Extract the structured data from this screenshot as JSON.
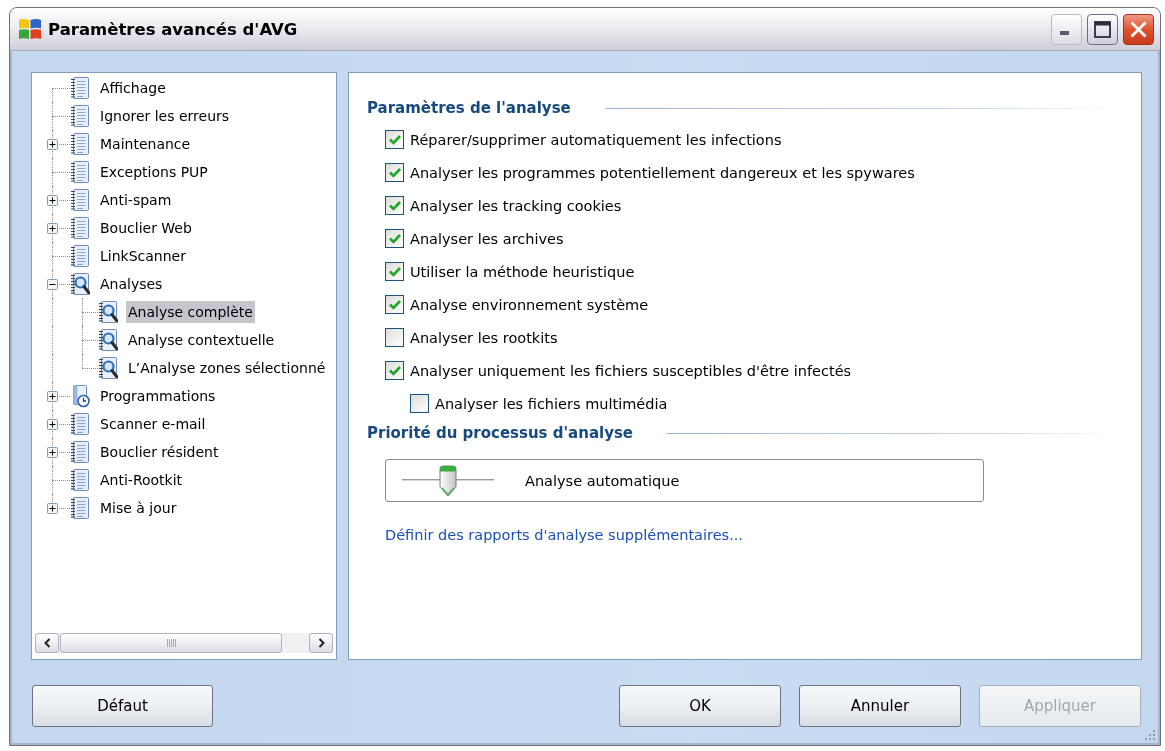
{
  "window": {
    "title": "Paramètres avancés d'AVG"
  },
  "tree": {
    "items": [
      {
        "label": "Affichage",
        "kind": "notepad",
        "selected": false
      },
      {
        "label": "Ignorer les erreurs",
        "kind": "notepad",
        "selected": false
      },
      {
        "label": "Maintenance",
        "kind": "notepad",
        "selected": false,
        "expanded": false
      },
      {
        "label": "Exceptions PUP",
        "kind": "notepad",
        "selected": false
      },
      {
        "label": "Anti-spam",
        "kind": "notepad",
        "selected": false,
        "expanded": false
      },
      {
        "label": "Bouclier Web",
        "kind": "notepad",
        "selected": false,
        "expanded": false
      },
      {
        "label": "LinkScanner",
        "kind": "notepad",
        "selected": false
      },
      {
        "label": "Analyses",
        "kind": "scan",
        "selected": false,
        "expanded": true,
        "children": [
          {
            "label": "Analyse complète",
            "kind": "scan",
            "selected": true
          },
          {
            "label": "Analyse contextuelle",
            "kind": "scan",
            "selected": false
          },
          {
            "label": "L’Analyse zones sélectionné",
            "kind": "scan",
            "selected": false
          }
        ]
      },
      {
        "label": "Programmations",
        "kind": "schedule",
        "selected": false,
        "expanded": false
      },
      {
        "label": "Scanner e-mail",
        "kind": "notepad",
        "selected": false,
        "expanded": false
      },
      {
        "label": "Bouclier résident",
        "kind": "notepad",
        "selected": false,
        "expanded": false
      },
      {
        "label": "Anti-Rootkit",
        "kind": "notepad",
        "selected": false
      },
      {
        "label": "Mise à jour",
        "kind": "notepad",
        "selected": false,
        "expanded": false
      }
    ]
  },
  "analysis_settings": {
    "title": "Paramètres de l'analyse",
    "options": [
      {
        "label": "Réparer/supprimer automatiquement les infections",
        "checked": true
      },
      {
        "label": "Analyser les programmes potentiellement dangereux et les spywares",
        "checked": true
      },
      {
        "label": "Analyser les tracking cookies",
        "checked": true
      },
      {
        "label": "Analyser les archives",
        "checked": true
      },
      {
        "label": "Utiliser la méthode heuristique",
        "checked": true
      },
      {
        "label": "Analyse environnement système",
        "checked": true
      },
      {
        "label": "Analyser les rootkits",
        "checked": false
      },
      {
        "label": "Analyser uniquement les fichiers susceptibles d'être infectés",
        "checked": true,
        "children": [
          {
            "label": "Analyser les fichiers multimédia",
            "checked": false
          }
        ]
      }
    ]
  },
  "priority": {
    "title": "Priorité du processus d'analyse",
    "slider": {
      "level": 0.5,
      "label": "Analyse automatique"
    }
  },
  "reports_link": "Définir des rapports d'analyse supplémentaires...",
  "footer": {
    "left_buttons": [
      {
        "label": "Défaut",
        "disabled": false
      }
    ],
    "right_buttons": [
      {
        "label": "OK",
        "disabled": false
      },
      {
        "label": "Annuler",
        "disabled": false
      },
      {
        "label": "Appliquer",
        "disabled": true
      }
    ]
  }
}
